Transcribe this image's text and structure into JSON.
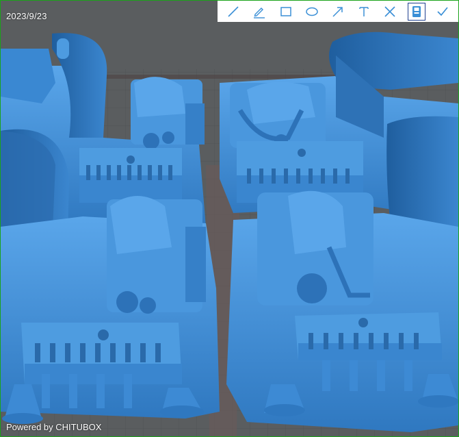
{
  "overlay": {
    "timestamp": "2023/9/23",
    "powered_by": "Powered by CHITUBOX"
  },
  "toolbar": {
    "tools": [
      {
        "name": "line-tool",
        "icon": "line-icon",
        "active": false
      },
      {
        "name": "pen-tool",
        "icon": "pencil-icon",
        "active": false
      },
      {
        "name": "rectangle-tool",
        "icon": "rectangle-icon",
        "active": false
      },
      {
        "name": "ellipse-tool",
        "icon": "ellipse-icon",
        "active": false
      },
      {
        "name": "arrow-tool",
        "icon": "arrow-icon",
        "active": false
      },
      {
        "name": "text-tool",
        "icon": "text-icon",
        "active": false
      },
      {
        "name": "close-tool",
        "icon": "close-icon",
        "active": false
      },
      {
        "name": "save-tool",
        "icon": "save-icon",
        "active": true
      },
      {
        "name": "confirm-tool",
        "icon": "check-icon",
        "active": false
      }
    ],
    "icon_color": "#3a8fd6",
    "active_border_color": "#1f3f8f"
  },
  "scene": {
    "model_color": "#3f8fd8",
    "background_color": "#5a5d5f"
  }
}
